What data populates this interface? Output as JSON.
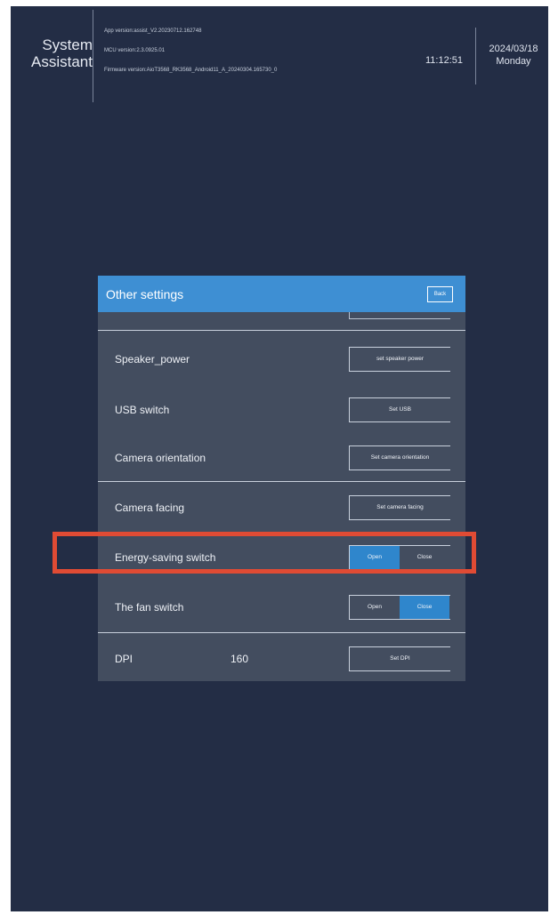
{
  "header": {
    "app_title_line1": "System",
    "app_title_line2": "Assistant",
    "app_version": "App version:assist_V2.20230712.162748",
    "mcu_version": "MCU version:2.3.0925.01",
    "firmware_version": "Firmware version:AioT3568_RK3568_Android11_A_20240304.165730_0",
    "time": "11:12:51",
    "date": "2024/03/18",
    "weekday": "Monday"
  },
  "dialog": {
    "title": "Other settings",
    "back_label": "Back",
    "rows": [
      {
        "label": "Speaker_power",
        "button": "set speaker power"
      },
      {
        "label": "USB switch",
        "button": "Set USB"
      },
      {
        "label": "Camera orientation",
        "button": "Set camera orientation"
      },
      {
        "label": "Camera facing",
        "button": "Set camera facing"
      },
      {
        "label": "Energy-saving switch",
        "options": [
          "Open",
          "Close"
        ],
        "selected": "Open"
      },
      {
        "label": "The fan switch",
        "options": [
          "Open",
          "Close"
        ],
        "selected": "Close"
      },
      {
        "label": "DPI",
        "value": "160",
        "button": "Set DPI"
      }
    ]
  },
  "colors": {
    "background": "#232d45",
    "dialog_header": "#3e8fd3",
    "dialog_body": "#434d5f",
    "toggle_active": "#2f86cc",
    "highlight": "#e04b34"
  }
}
